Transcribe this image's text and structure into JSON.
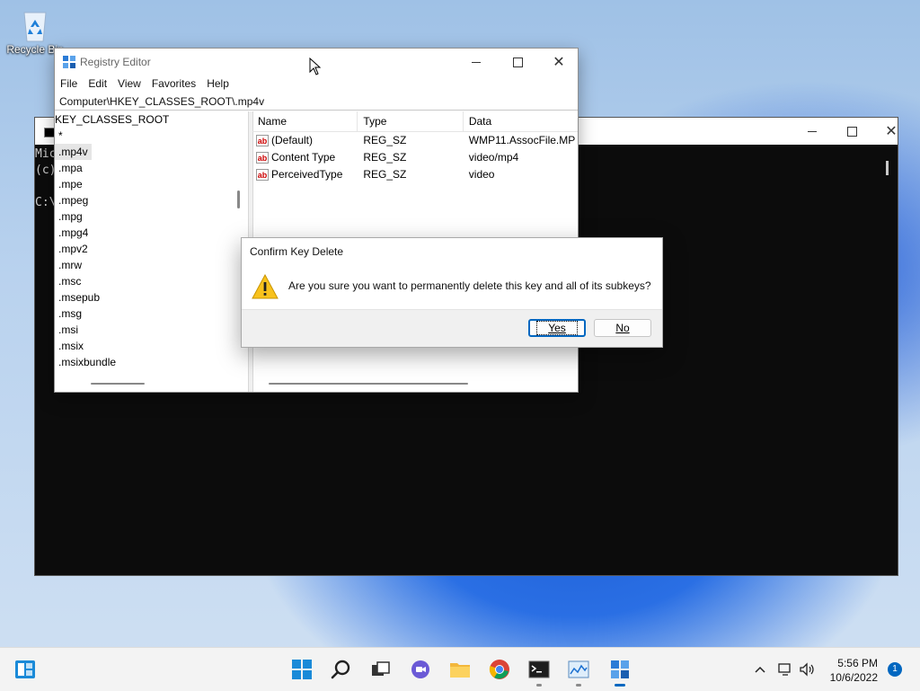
{
  "desktop": {
    "recycle_bin_label": "Recycle Bin"
  },
  "console": {
    "lines": [
      "Mic",
      "(c)",
      "",
      "C:\\"
    ]
  },
  "regedit": {
    "title": "Registry Editor",
    "menu": [
      "File",
      "Edit",
      "View",
      "Favorites",
      "Help"
    ],
    "address": "Computer\\HKEY_CLASSES_ROOT\\.mp4v",
    "tree": {
      "root": "KEY_CLASSES_ROOT",
      "items": [
        "*",
        ".mp4v",
        ".mpa",
        ".mpe",
        ".mpeg",
        ".mpg",
        ".mpg4",
        ".mpv2",
        ".mrw",
        ".msc",
        ".msepub",
        ".msg",
        ".msi",
        ".msix",
        ".msixbundle"
      ],
      "selected": ".mp4v"
    },
    "columns": {
      "name": "Name",
      "type": "Type",
      "data": "Data"
    },
    "values": [
      {
        "name": "(Default)",
        "type": "REG_SZ",
        "data": "WMP11.AssocFile.MP"
      },
      {
        "name": "Content Type",
        "type": "REG_SZ",
        "data": "video/mp4"
      },
      {
        "name": "PerceivedType",
        "type": "REG_SZ",
        "data": "video"
      }
    ],
    "value_icon": "ab-string-icon"
  },
  "dialog": {
    "title": "Confirm Key Delete",
    "message": "Are you sure you want to permanently delete this key and all of its subkeys?",
    "yes_label": "Yes",
    "no_label": "No"
  },
  "taskbar": {
    "time": "5:56 PM",
    "date": "10/6/2022",
    "notification_count": "1",
    "icons": [
      "widgets-icon",
      "start-icon",
      "search-icon",
      "task-view-icon",
      "chat-icon",
      "file-explorer-icon",
      "chrome-icon",
      "terminal-icon",
      "resource-monitor-icon",
      "registry-editor-icon"
    ]
  },
  "colors": {
    "accent": "#0067c0",
    "console_bg": "#0c0c0c",
    "taskbar_bg": "#f3f3f3"
  }
}
